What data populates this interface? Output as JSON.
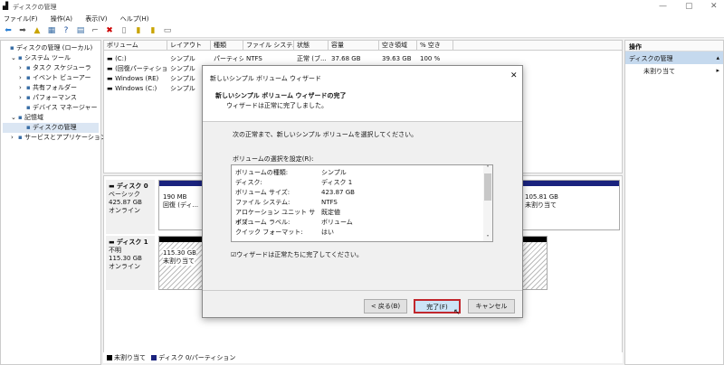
{
  "window": {
    "title": "ディスクの管理",
    "min": "—",
    "max": "▢",
    "close": "✕"
  },
  "menu": [
    "ファイル(F)",
    "操作(A)",
    "表示(V)",
    "ヘルプ(H)"
  ],
  "tree": [
    {
      "label": "ディスクの管理 (ローカル)",
      "indent": 0,
      "exp": ""
    },
    {
      "label": "システム ツール",
      "indent": 1,
      "exp": "⌄"
    },
    {
      "label": "タスク スケジューラ",
      "indent": 2,
      "exp": "›"
    },
    {
      "label": "イベント ビューアー",
      "indent": 2,
      "exp": "›"
    },
    {
      "label": "共有フォルダー",
      "indent": 2,
      "exp": "›"
    },
    {
      "label": "パフォーマンス",
      "indent": 2,
      "exp": "›"
    },
    {
      "label": "デバイス マネージャー",
      "indent": 2,
      "exp": ""
    },
    {
      "label": "記憶域",
      "indent": 1,
      "exp": "⌄"
    },
    {
      "label": "ディスクの管理",
      "indent": 2,
      "exp": ""
    },
    {
      "label": "サービスとアプリケーション",
      "indent": 1,
      "exp": "›"
    }
  ],
  "volumes": {
    "headers": [
      "ボリューム",
      "レイアウト",
      "種類",
      "ファイル システム",
      "状態",
      "容量",
      "空き領域",
      "% 空き"
    ],
    "rows": [
      [
        "(C:)",
        "シンプル",
        "パーティション",
        "NTFS",
        "正常 (ブ...",
        "37.68 GB",
        "39.63 GB",
        "100 %"
      ],
      [
        "(回復パーティション)",
        "シンプル",
        "",
        "",
        "",
        "",
        "",
        ""
      ],
      [
        "Windows (RE)",
        "シンプル",
        "",
        "",
        "",
        "",
        "",
        ""
      ],
      [
        "Windows (C:)",
        "シンプル",
        "",
        "",
        "",
        "",
        "",
        ""
      ]
    ]
  },
  "disks": [
    {
      "name": "ディスク 0",
      "type": "ベーシック",
      "size": "425.87 GB",
      "status": "オンライン",
      "p1_size": "190 MB",
      "p1_label": "回復 (ディ...",
      "p2_size": "105.81 GB",
      "p2_label": "未割り当て"
    },
    {
      "name": "ディスク 1",
      "type": "不明",
      "size": "115.30 GB",
      "status": "オンライン",
      "p1_size": "115.30 GB",
      "p1_label": "未割り当て"
    }
  ],
  "legend": [
    "未割り当て",
    "ディスク 0/パーティション"
  ],
  "actions": {
    "header": "操作",
    "section": "ディスクの管理",
    "item": "未割り当て"
  },
  "dialog": {
    "title": "新しいシンプル ボリューム ウィザード",
    "heading": "新しいシンプル ボリューム ウィザードの完了",
    "subheading": "ウィザードは正常に完了しました。",
    "intro": "次の正常まで、新しいシンプル ボリュームを選択してください。",
    "list_label": "ボリュームの選択を設定(R):",
    "settings": [
      [
        "ボリュームの種類:",
        "シンプル"
      ],
      [
        "ディスク:",
        "ディスク 1"
      ],
      [
        "ボリューム サイズ:",
        "423.87 GB"
      ],
      [
        "ファイル システム:",
        "NTFS"
      ],
      [
        "アロケーション ユニット サイズ:",
        "既定値"
      ],
      [
        "ボリューム ラベル:",
        "ボリューム"
      ],
      [
        "クイック フォーマット:",
        "はい"
      ]
    ],
    "checkbox": "ウィザードは正常たちに完了してください。",
    "back": "< 戻る(B)",
    "finish": "完了(F)",
    "cancel": "キャンセル",
    "close": "✕"
  }
}
